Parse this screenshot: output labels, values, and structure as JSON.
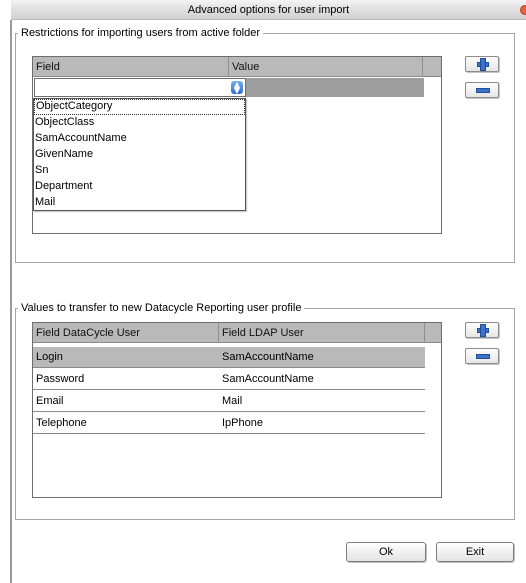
{
  "window": {
    "title": "Advanced options for user import"
  },
  "restrictions": {
    "legend": "Restrictions for importing users from active folder",
    "columns": [
      "Field",
      "Value"
    ],
    "combo_value": "",
    "dropdown_options": [
      "ObjectCategory",
      "ObjectClass",
      "SamAccountName",
      "GivenName",
      "Sn",
      "Department",
      "Mail"
    ],
    "highlighted_option": "ObjectCategory"
  },
  "transfer": {
    "legend": "Values to transfer to new Datacycle Reporting user profile",
    "columns": [
      "Field DataCycle User",
      "Field LDAP User"
    ],
    "rows": [
      {
        "user": "Login",
        "ldap": "SamAccountName",
        "selected": true
      },
      {
        "user": "Password",
        "ldap": "SamAccountName",
        "selected": false
      },
      {
        "user": "Email",
        "ldap": "Mail",
        "selected": false
      },
      {
        "user": "Telephone",
        "ldap": "IpPhone",
        "selected": false
      }
    ]
  },
  "buttons": {
    "ok": "Ok",
    "exit": "Exit"
  },
  "icons": {
    "add": "plus-icon",
    "remove": "minus-icon",
    "combo": "updown-arrow-icon",
    "close": "close-icon"
  },
  "colors": {
    "accent_blue": "#3a72c8",
    "header_gray": "#b9b9b9",
    "selected_row": "#b9b9b9"
  }
}
